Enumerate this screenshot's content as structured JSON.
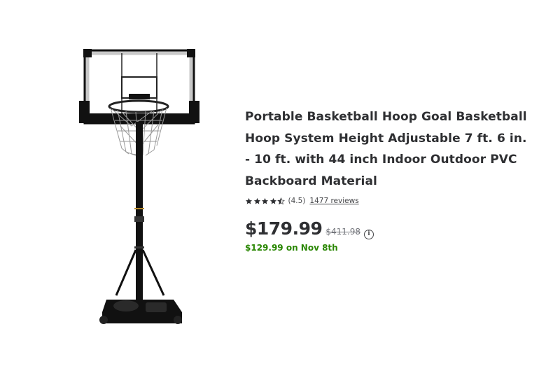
{
  "product": {
    "image_alt": "Portable basketball hoop",
    "title": "Portable Basketball Hoop Goal Basketball Hoop System Height Adjustable 7 ft. 6 in. - 10 ft. with 44 inch Indoor Outdoor PVC Backboard Material",
    "rating": {
      "stars": 4.5,
      "value_text": "(4.5)",
      "reviews_text": "1477 reviews"
    },
    "price": {
      "current": "$179.99",
      "was": "$411.98",
      "info_icon": "info-circle-icon",
      "future_text": "$129.99 on Nov 8th"
    }
  },
  "colors": {
    "title_text": "#2e2f32",
    "future_price_green": "#2a8703",
    "muted_text": "#74767c"
  }
}
